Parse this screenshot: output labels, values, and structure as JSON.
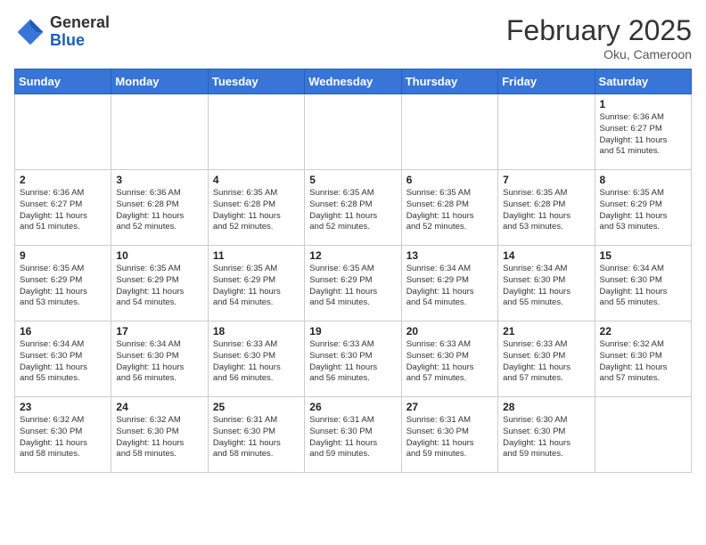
{
  "header": {
    "logo_line1": "General",
    "logo_line2": "Blue",
    "month_year": "February 2025",
    "location": "Oku, Cameroon"
  },
  "weekdays": [
    "Sunday",
    "Monday",
    "Tuesday",
    "Wednesday",
    "Thursday",
    "Friday",
    "Saturday"
  ],
  "weeks": [
    [
      {
        "day": "",
        "info": ""
      },
      {
        "day": "",
        "info": ""
      },
      {
        "day": "",
        "info": ""
      },
      {
        "day": "",
        "info": ""
      },
      {
        "day": "",
        "info": ""
      },
      {
        "day": "",
        "info": ""
      },
      {
        "day": "1",
        "info": "Sunrise: 6:36 AM\nSunset: 6:27 PM\nDaylight: 11 hours\nand 51 minutes."
      }
    ],
    [
      {
        "day": "2",
        "info": "Sunrise: 6:36 AM\nSunset: 6:27 PM\nDaylight: 11 hours\nand 51 minutes."
      },
      {
        "day": "3",
        "info": "Sunrise: 6:36 AM\nSunset: 6:28 PM\nDaylight: 11 hours\nand 52 minutes."
      },
      {
        "day": "4",
        "info": "Sunrise: 6:35 AM\nSunset: 6:28 PM\nDaylight: 11 hours\nand 52 minutes."
      },
      {
        "day": "5",
        "info": "Sunrise: 6:35 AM\nSunset: 6:28 PM\nDaylight: 11 hours\nand 52 minutes."
      },
      {
        "day": "6",
        "info": "Sunrise: 6:35 AM\nSunset: 6:28 PM\nDaylight: 11 hours\nand 52 minutes."
      },
      {
        "day": "7",
        "info": "Sunrise: 6:35 AM\nSunset: 6:28 PM\nDaylight: 11 hours\nand 53 minutes."
      },
      {
        "day": "8",
        "info": "Sunrise: 6:35 AM\nSunset: 6:29 PM\nDaylight: 11 hours\nand 53 minutes."
      }
    ],
    [
      {
        "day": "9",
        "info": "Sunrise: 6:35 AM\nSunset: 6:29 PM\nDaylight: 11 hours\nand 53 minutes."
      },
      {
        "day": "10",
        "info": "Sunrise: 6:35 AM\nSunset: 6:29 PM\nDaylight: 11 hours\nand 54 minutes."
      },
      {
        "day": "11",
        "info": "Sunrise: 6:35 AM\nSunset: 6:29 PM\nDaylight: 11 hours\nand 54 minutes."
      },
      {
        "day": "12",
        "info": "Sunrise: 6:35 AM\nSunset: 6:29 PM\nDaylight: 11 hours\nand 54 minutes."
      },
      {
        "day": "13",
        "info": "Sunrise: 6:34 AM\nSunset: 6:29 PM\nDaylight: 11 hours\nand 54 minutes."
      },
      {
        "day": "14",
        "info": "Sunrise: 6:34 AM\nSunset: 6:30 PM\nDaylight: 11 hours\nand 55 minutes."
      },
      {
        "day": "15",
        "info": "Sunrise: 6:34 AM\nSunset: 6:30 PM\nDaylight: 11 hours\nand 55 minutes."
      }
    ],
    [
      {
        "day": "16",
        "info": "Sunrise: 6:34 AM\nSunset: 6:30 PM\nDaylight: 11 hours\nand 55 minutes."
      },
      {
        "day": "17",
        "info": "Sunrise: 6:34 AM\nSunset: 6:30 PM\nDaylight: 11 hours\nand 56 minutes."
      },
      {
        "day": "18",
        "info": "Sunrise: 6:33 AM\nSunset: 6:30 PM\nDaylight: 11 hours\nand 56 minutes."
      },
      {
        "day": "19",
        "info": "Sunrise: 6:33 AM\nSunset: 6:30 PM\nDaylight: 11 hours\nand 56 minutes."
      },
      {
        "day": "20",
        "info": "Sunrise: 6:33 AM\nSunset: 6:30 PM\nDaylight: 11 hours\nand 57 minutes."
      },
      {
        "day": "21",
        "info": "Sunrise: 6:33 AM\nSunset: 6:30 PM\nDaylight: 11 hours\nand 57 minutes."
      },
      {
        "day": "22",
        "info": "Sunrise: 6:32 AM\nSunset: 6:30 PM\nDaylight: 11 hours\nand 57 minutes."
      }
    ],
    [
      {
        "day": "23",
        "info": "Sunrise: 6:32 AM\nSunset: 6:30 PM\nDaylight: 11 hours\nand 58 minutes."
      },
      {
        "day": "24",
        "info": "Sunrise: 6:32 AM\nSunset: 6:30 PM\nDaylight: 11 hours\nand 58 minutes."
      },
      {
        "day": "25",
        "info": "Sunrise: 6:31 AM\nSunset: 6:30 PM\nDaylight: 11 hours\nand 58 minutes."
      },
      {
        "day": "26",
        "info": "Sunrise: 6:31 AM\nSunset: 6:30 PM\nDaylight: 11 hours\nand 59 minutes."
      },
      {
        "day": "27",
        "info": "Sunrise: 6:31 AM\nSunset: 6:30 PM\nDaylight: 11 hours\nand 59 minutes."
      },
      {
        "day": "28",
        "info": "Sunrise: 6:30 AM\nSunset: 6:30 PM\nDaylight: 11 hours\nand 59 minutes."
      },
      {
        "day": "",
        "info": ""
      }
    ]
  ]
}
